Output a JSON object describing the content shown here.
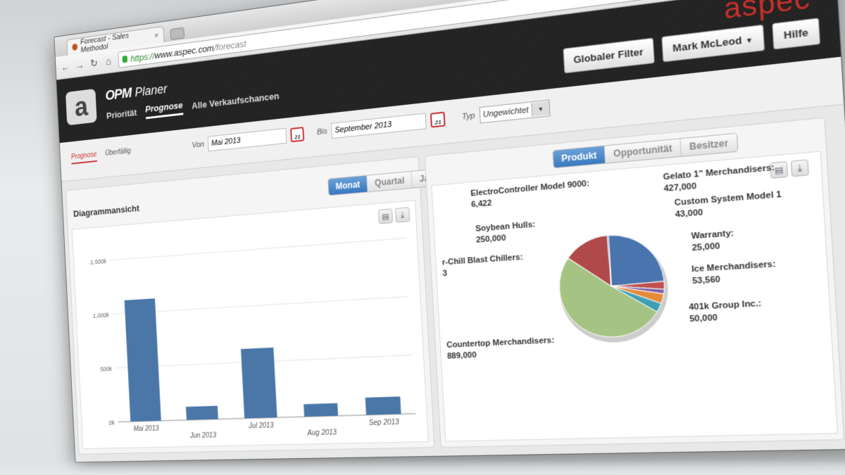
{
  "browser": {
    "tab_title": "Forecast - Sales Methodol",
    "tab_close": "×",
    "url_https": "https://",
    "url_host": "www.aspec.com",
    "url_path": "/forecast"
  },
  "header": {
    "brand_logo": "OPM",
    "brand_product": "Planer",
    "nav": [
      {
        "label": "Priorität",
        "active": false
      },
      {
        "label": "Prognose",
        "active": true
      },
      {
        "label": "Alle Verkaufschancen",
        "active": false
      }
    ],
    "company": "aspec",
    "buttons": {
      "filter": "Globaler Filter",
      "user": "Mark McLeod",
      "help": "Hilfe"
    }
  },
  "filters": {
    "tabs": [
      {
        "label": "Prognose",
        "active": true
      },
      {
        "label": "Überfällig",
        "active": false
      }
    ],
    "from_label": "Von",
    "from_value": "Mai 2013",
    "to_label": "Bis",
    "to_value": "September 2013",
    "type_label": "Typ",
    "type_value": "Ungewichtet",
    "calendar_day": "21"
  },
  "left_panel": {
    "title": "Diagrammansicht",
    "periods": [
      {
        "label": "Monat",
        "active": true
      },
      {
        "label": "Quartal",
        "active": false
      },
      {
        "label": "Jahr",
        "active": false
      }
    ]
  },
  "right_panel": {
    "groupings": [
      {
        "label": "Produkt",
        "active": true
      },
      {
        "label": "Opportunität",
        "active": false
      },
      {
        "label": "Besitzer",
        "active": false
      }
    ]
  },
  "chart_data": [
    {
      "type": "bar",
      "categories": [
        "Mai 2013",
        "Jun 2013",
        "Jul 2013",
        "Aug 2013",
        "Sep 2013"
      ],
      "values": [
        1120000,
        120000,
        620000,
        110000,
        150000
      ],
      "yticks": [
        "0k",
        "500k",
        "1,000k",
        "1,500k"
      ],
      "ylim": [
        0,
        1500000
      ],
      "grid": true,
      "color": "#4a76a8"
    },
    {
      "type": "pie",
      "slices": [
        {
          "label": "Gelato 1\" Merchandisers:",
          "value": 427000,
          "color": "#4a74ae"
        },
        {
          "label": "Custom System Model 1",
          "value": 43000,
          "color": "#c0504d"
        },
        {
          "label": "Warranty:",
          "value": 25000,
          "color": "#7b5ea8"
        },
        {
          "label": "Ice Merchandisers:",
          "value": 53560,
          "color": "#e48b3c"
        },
        {
          "label": "401k Group Inc.:",
          "value": 50000,
          "color": "#3f9fb5"
        },
        {
          "label": "Countertop Merchandisers:",
          "value": 889000,
          "color": "#a5c484"
        },
        {
          "label": "r-Chill Blast Chillers:",
          "value": 3,
          "color": "#9aaed0"
        },
        {
          "label": "Soybean Hulls:",
          "value": 250000,
          "color": "#b04a4a"
        },
        {
          "label": "ElectroController Model 9000:",
          "value": 6422,
          "color": "#3d69a6"
        }
      ],
      "display_values": [
        "427,000",
        "43,000",
        "25,000",
        "53,560",
        "50,000",
        "889,000",
        "3",
        "250,000",
        "6,422"
      ]
    }
  ]
}
